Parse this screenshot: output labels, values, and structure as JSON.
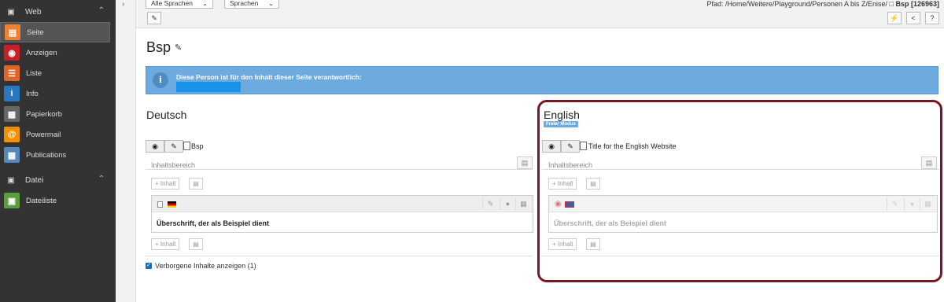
{
  "sidebar": {
    "groups": [
      {
        "label": "Web",
        "items": [
          {
            "label": "Seite",
            "color": "#f08133"
          },
          {
            "label": "Anzeigen",
            "color": "#c8202a"
          },
          {
            "label": "Liste",
            "color": "#e06627"
          },
          {
            "label": "Info",
            "color": "#2a78c4"
          },
          {
            "label": "Papierkorb",
            "color": "#666666"
          },
          {
            "label": "Powermail",
            "color": "#f29100"
          },
          {
            "label": "Publications",
            "color": "#5588bb"
          }
        ]
      },
      {
        "label": "Datei",
        "items": [
          {
            "label": "Dateiliste",
            "color": "#5a9e3a"
          }
        ]
      }
    ]
  },
  "topbar": {
    "lang_select": "Alle Sprachen",
    "lang_select2": "Sprachen",
    "path_prefix": "Pfad: /Home/Weitere/Playground/Personen A bis Z/Enise/",
    "page_ref": "Bsp [126963]"
  },
  "main": {
    "title": "Bsp",
    "info_text": "Diese Person ist für den Inhalt dieser Seite verantwortlich:",
    "columns": [
      {
        "title": "Deutsch",
        "page_label": "Bsp",
        "area_label": "Inhaltsbereich",
        "add_label": "Inhalt",
        "element_heading": "Überschrift, der als Beispiel dient"
      },
      {
        "title": "English",
        "badge": "Freier Modus",
        "page_label": "Title for the English Website",
        "area_label": "Inhaltsbereich",
        "add_label": "Inhalt",
        "element_heading": "Überschrift, der als Beispiel dient"
      }
    ],
    "hidden_toggle": "Verborgene Inhalte anzeigen (1)"
  }
}
